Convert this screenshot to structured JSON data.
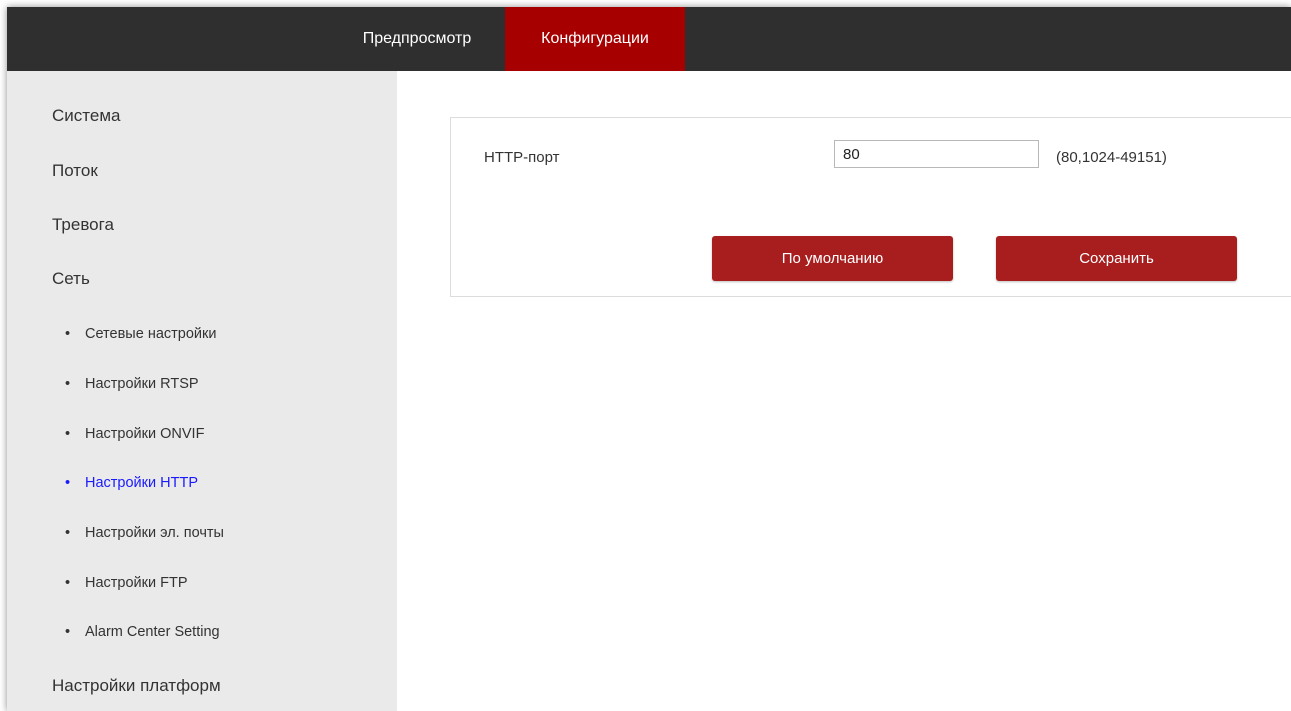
{
  "header": {
    "tabs": [
      {
        "label": "Предпросмотр",
        "active": false
      },
      {
        "label": "Конфигурации",
        "active": true
      }
    ],
    "background_color": "#2f2f2f",
    "active_tab_color": "#a60000"
  },
  "sidebar": {
    "items": [
      {
        "label": "Система",
        "level": 0
      },
      {
        "label": "Поток",
        "level": 0
      },
      {
        "label": "Тревога",
        "level": 0
      },
      {
        "label": "Сеть",
        "level": 0
      },
      {
        "label": "Сетевые настройки",
        "level": 1
      },
      {
        "label": "Настройки RTSP",
        "level": 1
      },
      {
        "label": "Настройки ONVIF",
        "level": 1
      },
      {
        "label": "Настройки HTTP",
        "level": 1,
        "active": true
      },
      {
        "label": "Настройки эл. почты",
        "level": 1
      },
      {
        "label": "Настройки FTP",
        "level": 1
      },
      {
        "label": "Alarm Center Setting",
        "level": 1
      },
      {
        "label": "Настройки платформ",
        "level": 0
      }
    ],
    "bullet": "•",
    "active_color": "#1a1aff"
  },
  "form": {
    "http_port": {
      "label": "HTTP-порт",
      "value": "80",
      "hint": "(80,1024-49151)"
    },
    "buttons": {
      "default_label": "По умолчанию",
      "save_label": "Сохранить"
    },
    "button_color": "#a81e1e"
  }
}
